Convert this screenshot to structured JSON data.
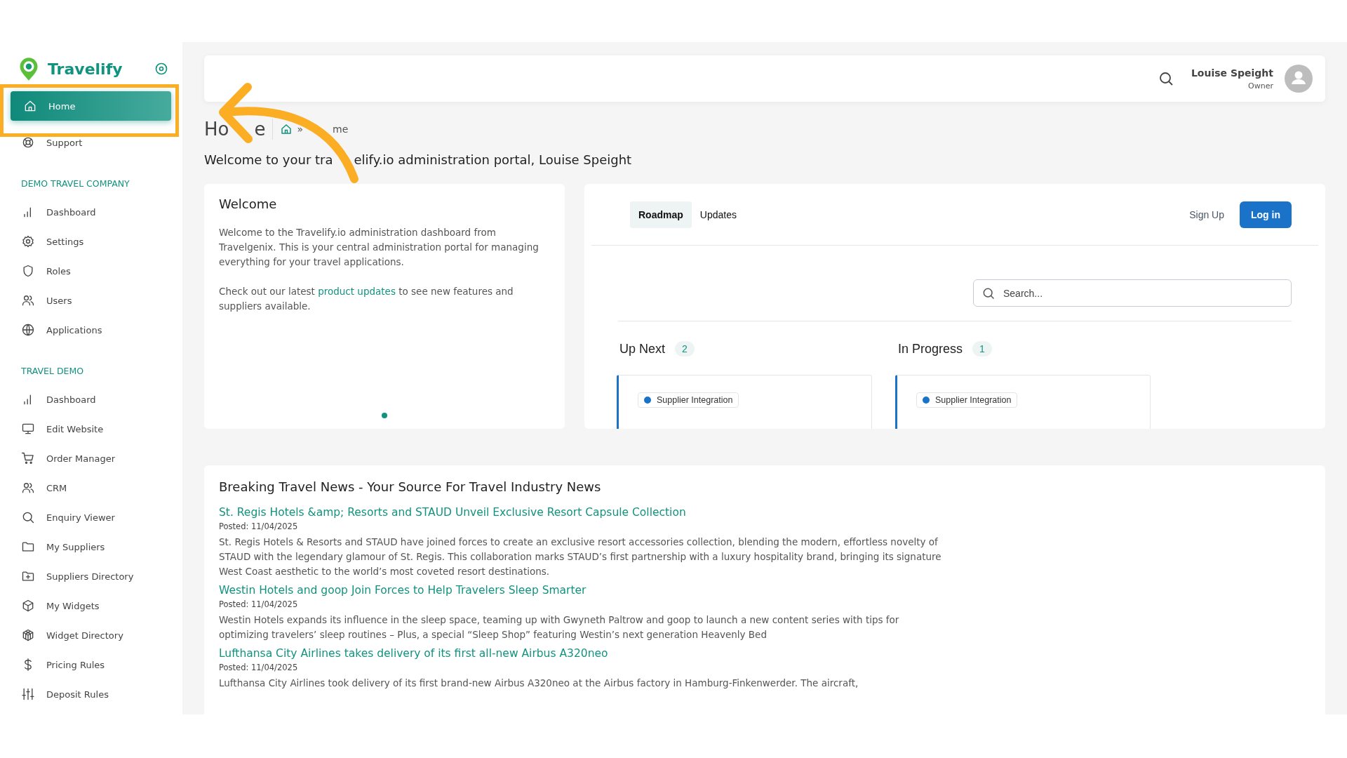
{
  "sidebar": {
    "logo": "Travelify",
    "items": [
      {
        "label": "Home",
        "selected": true
      },
      {
        "label": "Support",
        "selected": false
      }
    ],
    "sections": [
      {
        "heading": "DEMO TRAVEL COMPANY",
        "items": [
          {
            "label": "Dashboard",
            "selected": false
          },
          {
            "label": "Settings",
            "selected": false
          },
          {
            "label": "Roles",
            "selected": false
          },
          {
            "label": "Users",
            "selected": false
          },
          {
            "label": "Applications",
            "selected": false
          }
        ]
      },
      {
        "heading": "TRAVEL DEMO",
        "items": [
          {
            "label": "Dashboard",
            "selected": false
          },
          {
            "label": "Edit Website",
            "selected": false
          },
          {
            "label": "Order Manager",
            "selected": false
          },
          {
            "label": "CRM",
            "selected": false
          },
          {
            "label": "Enquiry Viewer",
            "selected": false
          },
          {
            "label": "My Suppliers",
            "selected": false
          },
          {
            "label": "Suppliers Directory",
            "selected": false
          },
          {
            "label": "My Widgets",
            "selected": false
          },
          {
            "label": "Widget Directory",
            "selected": false
          },
          {
            "label": "Pricing Rules",
            "selected": false
          },
          {
            "label": "Deposit Rules",
            "selected": false
          }
        ]
      }
    ]
  },
  "header": {
    "user_name": "Louise Speight",
    "user_role": "Owner"
  },
  "page": {
    "title_parts": [
      "Ho",
      "e"
    ],
    "breadcrumb_separator": "»",
    "breadcrumb": "me",
    "greeting_parts": [
      "Welcome to your tra",
      "elify.io administration portal, Louise Speight"
    ]
  },
  "welcome_card": {
    "title": "Welcome",
    "paragraphs": [
      "Welcome to the Travelify.io administration dashboard from Travelgenix. This is your central administration portal for managing everything for your travel applications."
    ],
    "link_paragraph": {
      "before": "Check out our latest ",
      "link": "product updates",
      "after": " to see new features and suppliers available."
    }
  },
  "roadmap": {
    "tabs": [
      {
        "label": "Roadmap",
        "selected": true
      },
      {
        "label": "Updates",
        "selected": false
      }
    ],
    "sign_up": "Sign Up",
    "log_in": "Log in",
    "search": {
      "placeholder": "Search..."
    },
    "columns": [
      {
        "title": "Up Next",
        "count": "2",
        "cards": [
          {
            "tag": "Supplier Integration"
          }
        ]
      },
      {
        "title": "In Progress",
        "count": "1",
        "cards": [
          {
            "tag": "Supplier Integration"
          }
        ]
      }
    ]
  },
  "news": {
    "title": "Breaking Travel News - Your Source For Travel Industry News",
    "items": [
      {
        "title": "St. Regis Hotels &amp; Resorts and STAUD Unveil Exclusive Resort Capsule Collection",
        "posted": "Posted: 11/04/2025",
        "body": "St. Regis Hotels & Resorts and STAUD have joined forces to create an exclusive resort accessories collection, blending the modern, effortless novelty of STAUD with the legendary glamour of St. Regis. This collaboration marks STAUD’s first partnership with a luxury hospitality brand, bringing its signature West Coast aesthetic to the world’s most coveted resort destinations."
      },
      {
        "title": "Westin Hotels and goop Join Forces to Help Travelers Sleep Smarter",
        "posted": "Posted: 11/04/2025",
        "body": "Westin Hotels expands its influence in the sleep space, teaming up with Gwyneth Paltrow and goop to launch a new content series with tips for optimizing travelers’ sleep routines – Plus, a special “Sleep Shop” featuring Westin’s next generation Heavenly Bed"
      },
      {
        "title": "Lufthansa City Airlines takes delivery of its first all-new Airbus A320neo",
        "posted": "Posted: 11/04/2025",
        "body": "Lufthansa City Airlines took delivery of its first brand-new Airbus A320neo at the Airbus factory in Hamburg-Finkenwerder. The aircraft,"
      }
    ]
  }
}
